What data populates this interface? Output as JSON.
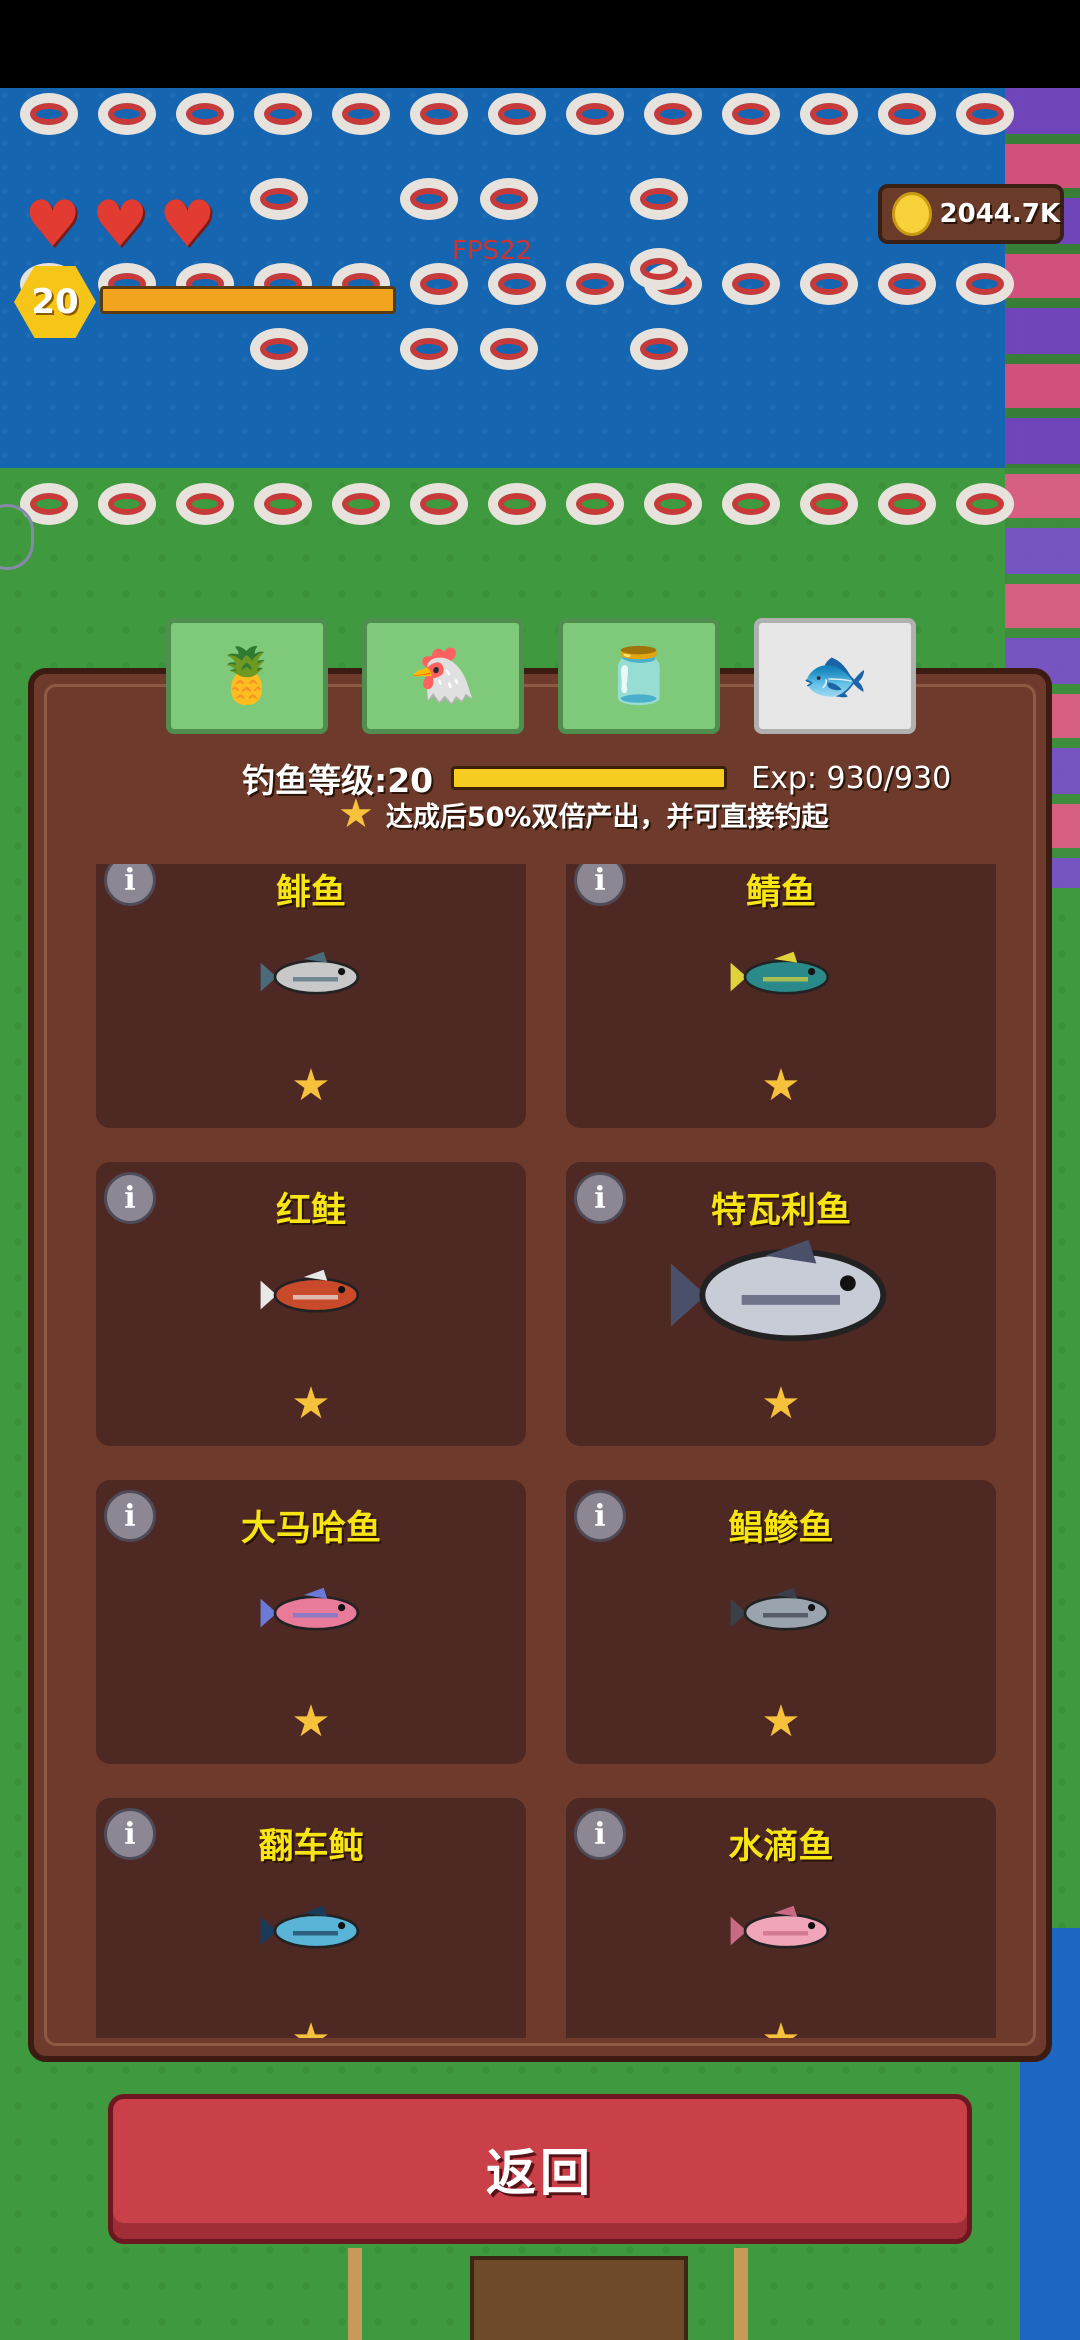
{
  "hud": {
    "hearts": 3,
    "level": "20",
    "fps": "FPS22",
    "coins": "2044.7K"
  },
  "tabs": [
    {
      "icon": "pineapple-icon",
      "glyph": "🍍",
      "active": false
    },
    {
      "icon": "chicken-icon",
      "glyph": "🐔",
      "active": false
    },
    {
      "icon": "jar-icon",
      "glyph": "🫙",
      "active": false
    },
    {
      "icon": "fish-icon",
      "glyph": "🐟",
      "active": true
    }
  ],
  "panel": {
    "level_label": "钓鱼等级:20",
    "exp_label": "Exp: 930/930",
    "exp_progress": 1.0,
    "bonus_text": "达成后50%双倍产出，并可直接钓起"
  },
  "fish": [
    {
      "name": "鲱鱼",
      "stars": 1,
      "color": "#c8c8c8",
      "accent": "#4a6b7a"
    },
    {
      "name": "鲭鱼",
      "stars": 1,
      "color": "#2a8a8a",
      "accent": "#e0d23a"
    },
    {
      "name": "红鲑",
      "stars": 1,
      "color": "#c84a2a",
      "accent": "#e8e8e8"
    },
    {
      "name": "特瓦利鱼",
      "stars": 1,
      "color": "#c8ccd6",
      "accent": "#4a4f6a"
    },
    {
      "name": "大马哈鱼",
      "stars": 1,
      "color": "#e87a9a",
      "accent": "#6a7ad8"
    },
    {
      "name": "鲳鲹鱼",
      "stars": 1,
      "color": "#9aa4ae",
      "accent": "#3a3f4a"
    },
    {
      "name": "翻车鲀",
      "stars": 1,
      "color": "#5ab4d8",
      "accent": "#1a3a5a"
    },
    {
      "name": "水滴鱼",
      "stars": 1,
      "color": "#f0a6b8",
      "accent": "#c86a84"
    }
  ],
  "info_label": "i",
  "star_glyph": "★",
  "buttons": {
    "back": "返回"
  }
}
